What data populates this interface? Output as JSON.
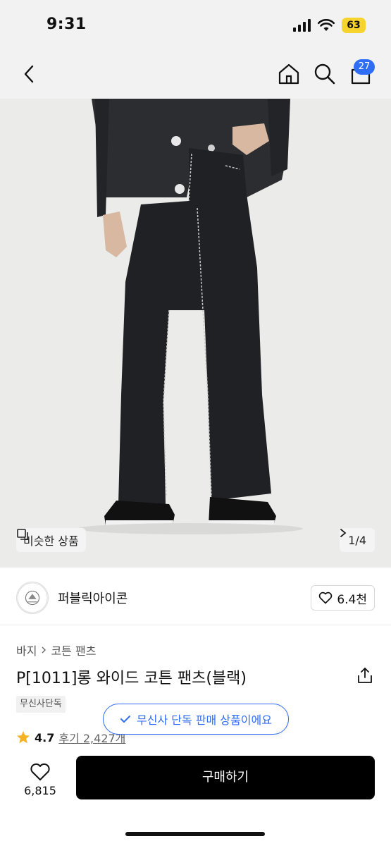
{
  "status_bar": {
    "time": "9:31",
    "battery": "63"
  },
  "nav": {
    "cart_count": "27"
  },
  "hero": {
    "similar_label": "비슷한 상품",
    "page_indicator": "1/4"
  },
  "brand": {
    "name": "퍼블릭아이콘",
    "likes": "6.4천"
  },
  "breadcrumb": [
    "바지",
    "코튼 팬츠"
  ],
  "product": {
    "title": "P[1011]롱 와이드 코튼 팬츠(블랙)",
    "tag": "무신사단독",
    "rating": "4.7",
    "reviews": "후기 2,427개"
  },
  "toast": {
    "text": "무신사 단독 판매 상품이에요"
  },
  "bottom": {
    "wish_count": "6,815",
    "buy_label": "구매하기"
  },
  "colors": {
    "accent": "#2f6df6",
    "battery": "#f6d32d",
    "star": "#f5b323",
    "buy": "#000000"
  }
}
